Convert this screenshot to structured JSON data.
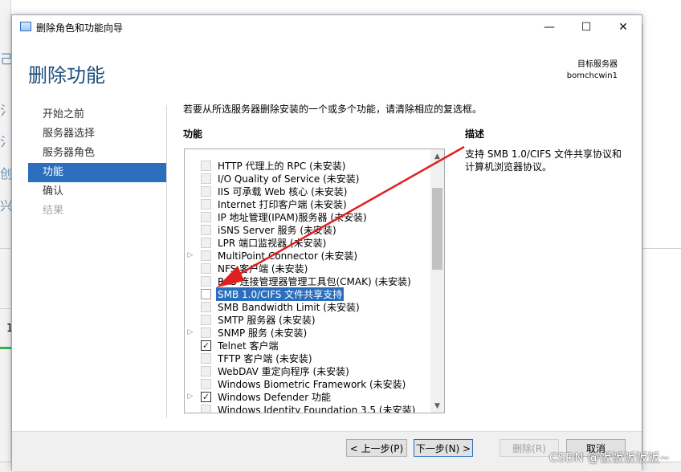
{
  "background": {
    "side_glyphs": [
      "己",
      "氵",
      "氵",
      "创",
      "兴"
    ],
    "row_number": "1",
    "watermark": "CSDN @饭饭饭饭饭~"
  },
  "dialog": {
    "title": "删除角色和功能向导",
    "window_buttons": {
      "minimize": "—",
      "maximize": "☐",
      "close": "✕"
    },
    "heading": "删除功能",
    "target_server_label": "目标服务器",
    "target_server_name": "bomchcwin1",
    "nav": [
      {
        "label": "开始之前",
        "state": "normal"
      },
      {
        "label": "服务器选择",
        "state": "normal"
      },
      {
        "label": "服务器角色",
        "state": "normal"
      },
      {
        "label": "功能",
        "state": "active"
      },
      {
        "label": "确认",
        "state": "normal"
      },
      {
        "label": "结果",
        "state": "disabled"
      }
    ],
    "instruction": "若要从所选服务器删除安装的一个或多个功能，请清除相应的复选框。",
    "features_label": "功能",
    "description_label": "描述",
    "description_text": "支持 SMB 1.0/CIFS 文件共享协议和计算机浏览器协议。",
    "features": [
      {
        "label": "HTTP 代理上的 RPC (未安装)",
        "state": "disabled",
        "expandable": false
      },
      {
        "label": "I/O Quality of Service (未安装)",
        "state": "disabled",
        "expandable": false
      },
      {
        "label": "IIS 可承载 Web 核心 (未安装)",
        "state": "disabled",
        "expandable": false
      },
      {
        "label": "Internet 打印客户端 (未安装)",
        "state": "disabled",
        "expandable": false
      },
      {
        "label": "IP 地址管理(IPAM)服务器 (未安装)",
        "state": "disabled",
        "expandable": false
      },
      {
        "label": "iSNS Server 服务 (未安装)",
        "state": "disabled",
        "expandable": false
      },
      {
        "label": "LPR 端口监视器 (未安装)",
        "state": "disabled",
        "expandable": false
      },
      {
        "label": "MultiPoint Connector (未安装)",
        "state": "disabled",
        "expandable": true
      },
      {
        "label": "NFS 客户端 (未安装)",
        "state": "disabled",
        "expandable": false
      },
      {
        "label": "RAS 连接管理器管理工具包(CMAK) (未安装)",
        "state": "disabled",
        "expandable": false
      },
      {
        "label": "SMB 1.0/CIFS 文件共享支持",
        "state": "unchecked",
        "expandable": false,
        "selected": true
      },
      {
        "label": "SMB Bandwidth Limit (未安装)",
        "state": "disabled",
        "expandable": false
      },
      {
        "label": "SMTP 服务器 (未安装)",
        "state": "disabled",
        "expandable": false
      },
      {
        "label": "SNMP 服务 (未安装)",
        "state": "disabled",
        "expandable": true
      },
      {
        "label": "Telnet 客户端",
        "state": "checked",
        "expandable": false
      },
      {
        "label": "TFTP 客户端 (未安装)",
        "state": "disabled",
        "expandable": false
      },
      {
        "label": "WebDAV 重定向程序 (未安装)",
        "state": "disabled",
        "expandable": false
      },
      {
        "label": "Windows Biometric Framework (未安装)",
        "state": "disabled",
        "expandable": false
      },
      {
        "label": "Windows Defender 功能",
        "state": "checked",
        "expandable": true
      },
      {
        "label": "Windows Identity Foundation 3.5 (未安装)",
        "state": "disabled",
        "expandable": false
      }
    ],
    "buttons": {
      "previous": "< 上一步(P)",
      "next": "下一步(N) >",
      "remove": "删除(R)",
      "cancel": "取消"
    }
  },
  "colors": {
    "accent": "#2a6ebd",
    "annotation_arrow": "#e02020",
    "heading": "#1d4f7c"
  }
}
